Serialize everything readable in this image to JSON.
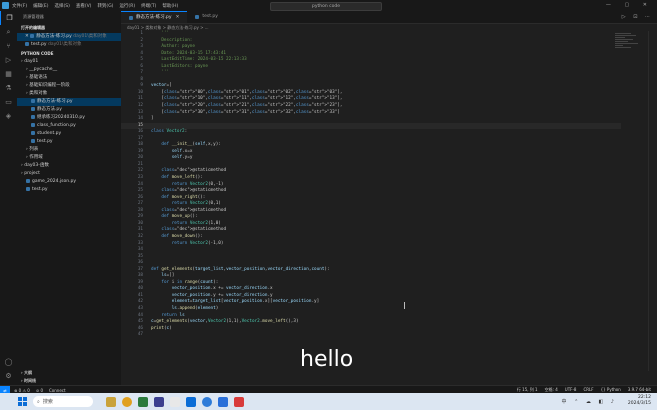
{
  "titlebar": {
    "menus": [
      "文件(F)",
      "编辑(E)",
      "选择(S)",
      "查看(V)",
      "转到(G)",
      "运行(R)",
      "终端(T)",
      "帮助(H)"
    ],
    "search": "python code",
    "window_controls": "— ▢ ✕"
  },
  "sidebar": {
    "title": "资源管理器",
    "open_editors_label": "打开的编辑器",
    "open_editors": [
      {
        "name": "静态方法-练习.py",
        "hint": "day01\\类和对象",
        "close": "✕"
      },
      {
        "name": "test.py",
        "hint": "day01\\类和对象"
      }
    ],
    "project_label": "PYTHON CODE",
    "tree": [
      {
        "label": "day01",
        "kind": "folder",
        "level": 0
      },
      {
        "label": "__pycache__",
        "kind": "folder",
        "level": 1
      },
      {
        "label": "基础语法",
        "kind": "folder",
        "level": 1
      },
      {
        "label": "基础知识编程一阶段",
        "kind": "folder",
        "level": 1
      },
      {
        "label": "类和对象",
        "kind": "folder",
        "level": 1
      },
      {
        "label": "静态方法-练习.py",
        "kind": "py",
        "level": 2,
        "selected": true
      },
      {
        "label": "静态方法.py",
        "kind": "py",
        "level": 2
      },
      {
        "label": "继承练习20240310.py",
        "kind": "py",
        "level": 2
      },
      {
        "label": "class_function.py",
        "kind": "py",
        "level": 2
      },
      {
        "label": "student.py",
        "kind": "py",
        "level": 2
      },
      {
        "label": "test.py",
        "kind": "py",
        "level": 2
      },
      {
        "label": "列表",
        "kind": "folder",
        "level": 1
      },
      {
        "label": "作用域",
        "kind": "folder",
        "level": 1
      },
      {
        "label": "day03-函数",
        "kind": "folder",
        "level": 0
      },
      {
        "label": "project",
        "kind": "folder",
        "level": 0
      },
      {
        "label": "game_2024.json.py",
        "kind": "py",
        "level": 1
      },
      {
        "label": "test.py",
        "kind": "py",
        "level": 1
      }
    ],
    "bottom": [
      "大纲",
      "时间线"
    ]
  },
  "tabs": [
    {
      "label": "静态方法-练习.py",
      "active": true,
      "close": "✕"
    },
    {
      "label": "test.py",
      "active": false
    }
  ],
  "breadcrumb": "day01 > 类和对象 > 静态方法-练习.py > ...",
  "code_lines": [
    {
      "n": "1",
      "t": "    '''"
    },
    {
      "n": "2",
      "t": "    Description:"
    },
    {
      "n": "3",
      "t": "    Author: payne"
    },
    {
      "n": "4",
      "t": "    Date: 2024-03-15 17:43:41"
    },
    {
      "n": "5",
      "t": "    LastEditTime: 2024-03-15 22:13:33"
    },
    {
      "n": "6",
      "t": "    LastEditors: payne"
    },
    {
      "n": "7",
      "t": "    '''"
    },
    {
      "n": "8",
      "t": ""
    },
    {
      "n": "9",
      "t": "vector=["
    },
    {
      "n": "10",
      "t": "    [\"00\",\"01\",\"02\",\"03\"],"
    },
    {
      "n": "11",
      "t": "    [\"10\",\"11\",\"12\",\"13\"],"
    },
    {
      "n": "12",
      "t": "    [\"20\",\"21\",\"22\",\"23\"],"
    },
    {
      "n": "13",
      "t": "    [\"30\",\"31\",\"32\",\"33\"]"
    },
    {
      "n": "14",
      "t": "]"
    },
    {
      "n": "15",
      "t": ""
    },
    {
      "n": "16",
      "t": "class Vector2:"
    },
    {
      "n": "17",
      "t": ""
    },
    {
      "n": "18",
      "t": "    def __init__(self,x,y):"
    },
    {
      "n": "19",
      "t": "        self.x=x"
    },
    {
      "n": "20",
      "t": "        self.y=y"
    },
    {
      "n": "21",
      "t": ""
    },
    {
      "n": "22",
      "t": "    @staticmethod"
    },
    {
      "n": "23",
      "t": "    def move_left():"
    },
    {
      "n": "24",
      "t": "        return Vector2(0,-1)"
    },
    {
      "n": "25",
      "t": "    @staticmethod"
    },
    {
      "n": "26",
      "t": "    def move_right():"
    },
    {
      "n": "27",
      "t": "        return Vector2(0,1)"
    },
    {
      "n": "28",
      "t": "    @staticmethod"
    },
    {
      "n": "29",
      "t": "    def move_up():"
    },
    {
      "n": "30",
      "t": "        return Vector2(1,0)"
    },
    {
      "n": "31",
      "t": "    @staticmethod"
    },
    {
      "n": "32",
      "t": "    def move_down():"
    },
    {
      "n": "33",
      "t": "        return Vector2(-1,0)"
    },
    {
      "n": "34",
      "t": ""
    },
    {
      "n": "35",
      "t": ""
    },
    {
      "n": "36",
      "t": ""
    },
    {
      "n": "37",
      "t": "def get_elements(target_list,vector_position,vector_direction,count):"
    },
    {
      "n": "38",
      "t": "    ls=[]"
    },
    {
      "n": "39",
      "t": "    for i in range(count):"
    },
    {
      "n": "40",
      "t": "        vector_position.x += vector_direction.x"
    },
    {
      "n": "41",
      "t": "        vector_position.y += vector_direction.y"
    },
    {
      "n": "42",
      "t": "        element=target_list[vector_position.x][vector_position.y]"
    },
    {
      "n": "43",
      "t": "        ls.append(element)"
    },
    {
      "n": "44",
      "t": "    return ls"
    },
    {
      "n": "45",
      "t": "c=get_elements(vector,Vector2(1,1),Vector2.move_left(),3)"
    },
    {
      "n": "46",
      "t": "print(c)"
    },
    {
      "n": "47",
      "t": ""
    }
  ],
  "overlay_text": "hello",
  "status": {
    "left": [
      "⊗ 0 ⚠ 0",
      "⊘ 0",
      "Connect"
    ],
    "right": [
      "行 15, 列 1",
      "空格: 4",
      "UTF-8",
      "CRLF",
      "{} Python",
      "3.9.7 64-bit"
    ]
  },
  "taskbar": {
    "search": "搜索",
    "time": "22:12",
    "date": "2024/3/15",
    "lang": "中"
  }
}
